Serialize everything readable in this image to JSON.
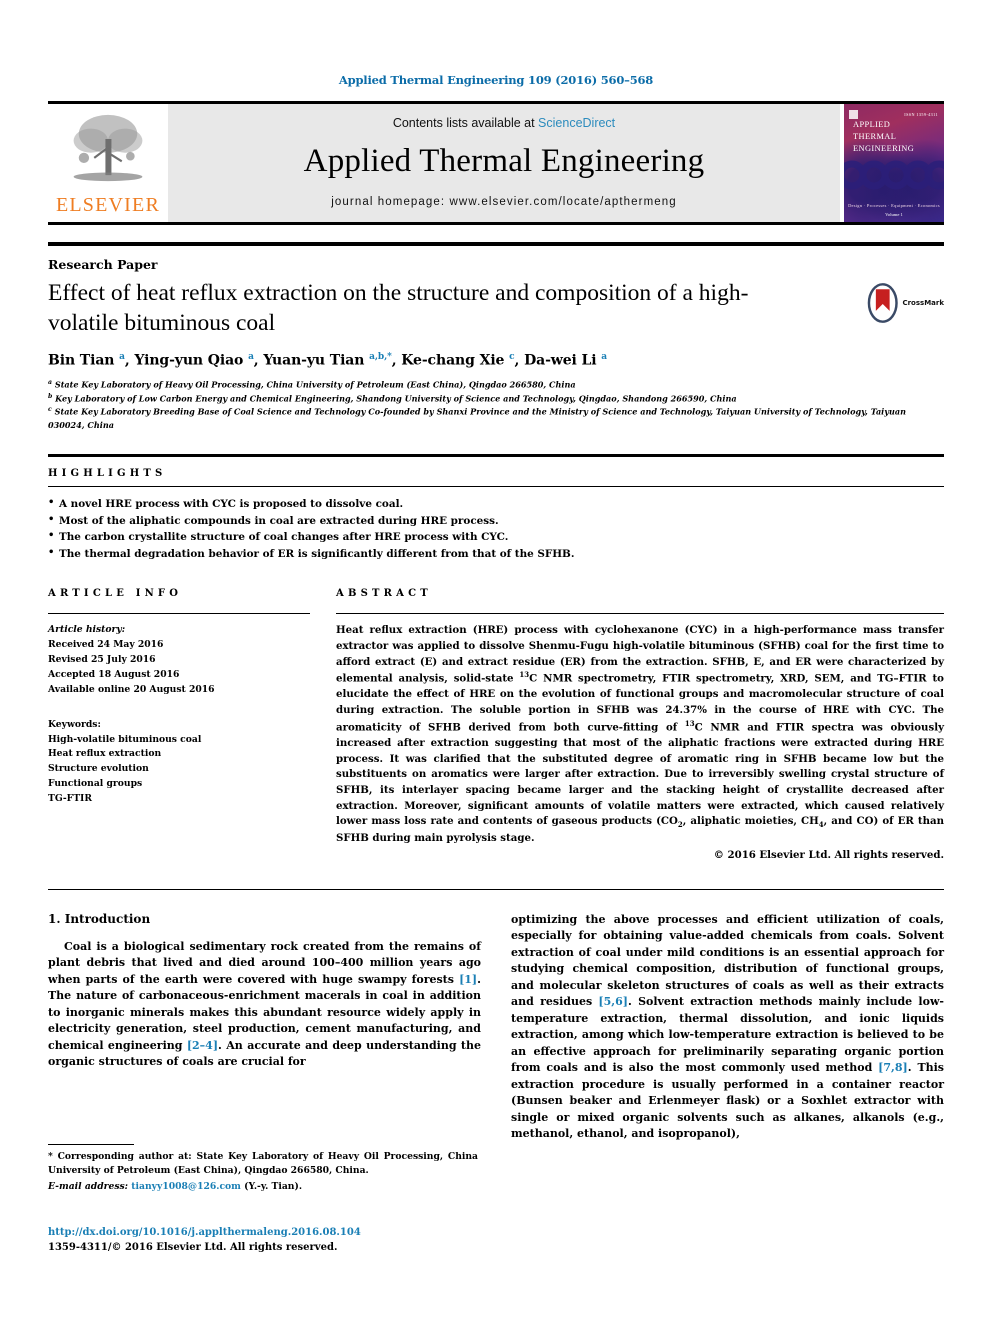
{
  "running_head": "Applied Thermal Engineering 109 (2016) 560–568",
  "masthead": {
    "contents_prefix": "Contents lists available at ",
    "sciencedirect": "ScienceDirect",
    "journal_name": "Applied Thermal Engineering",
    "homepage": "journal homepage: www.elsevier.com/locate/apthermeng",
    "publisher": "ELSEVIER",
    "cover": {
      "line1": "APPLIED",
      "line2": "THERMAL",
      "line3": "ENGINEERING",
      "footer": "Design · Processes · Equipment · Economics",
      "volume": "Volume 1",
      "issn": "ISSN 1359-4311"
    },
    "colors": {
      "link": "#2b8bbd",
      "elsevier_orange": "#ef7d22",
      "band_gray": "#e8e8e8"
    }
  },
  "article": {
    "type_label": "Research Paper",
    "title": "Effect of heat reflux extraction on the structure and composition of a high-volatile bituminous coal",
    "crossmark_label": "CrossMark",
    "authors_html": "Bin Tian <sup>a</sup>, Ying-yun Qiao <sup>a</sup>, Yuan-yu Tian <sup>a,b,</sup><sup>*</sup>, Ke-chang Xie <sup>c</sup>, Da-wei Li <sup>a</sup>",
    "affiliations": [
      "a State Key Laboratory of Heavy Oil Processing, China University of Petroleum (East China), Qingdao 266580, China",
      "b Key Laboratory of Low Carbon Energy and Chemical Engineering, Shandong University of Science and Technology, Qingdao, Shandong 266590, China",
      "c State Key Laboratory Breeding Base of Coal Science and Technology Co-founded by Shanxi Province and the Ministry of Science and Technology, Taiyuan University of Technology, Taiyuan 030024, China"
    ]
  },
  "highlights": {
    "heading": "HIGHLIGHTS",
    "items": [
      "A novel HRE process with CYC is proposed to dissolve coal.",
      "Most of the aliphatic compounds in coal are extracted during HRE process.",
      "The carbon crystallite structure of coal changes after HRE process with CYC.",
      "The thermal degradation behavior of ER is significantly different from that of the SFHB."
    ]
  },
  "article_info": {
    "heading": "ARTICLE INFO",
    "history_label": "Article history:",
    "history": [
      "Received 24 May 2016",
      "Revised 25 July 2016",
      "Accepted 18 August 2016",
      "Available online 20 August 2016"
    ],
    "keywords_label": "Keywords:",
    "keywords": [
      "High-volatile bituminous coal",
      "Heat reflux extraction",
      "Structure evolution",
      "Functional groups",
      "TG-FTIR"
    ]
  },
  "abstract": {
    "heading": "ABSTRACT",
    "paragraph_html": "Heat reflux extraction (HRE) process with cyclohexanone (CYC) in a high-performance mass transfer extractor was applied to dissolve Shenmu-Fugu high-volatile bituminous (SFHB) coal for the first time to afford extract (E) and extract residue (ER) from the extraction. SFHB, E, and ER were characterized by elemental analysis, solid-state <sup class=\"sm\">13</sup>C NMR spectrometry, FTIR spectrometry, XRD, SEM, and TG–FTIR to elucidate the effect of HRE on the evolution of functional groups and macromolecular structure of coal during extraction. The soluble portion in SFHB was 24.37% in the course of HRE with CYC. The aromaticity of SFHB derived from both curve-fitting of <sup class=\"sm\">13</sup>C NMR and FTIR spectra was obviously increased after extraction suggesting that most of the aliphatic fractions were extracted during HRE process. It was clarified that the substituted degree of aromatic ring in SFHB became low but the substituents on aromatics were larger after extraction. Due to irreversibly swelling crystal structure of SFHB, its interlayer spacing became larger and the stacking height of crystallite decreased after extraction. Moreover, significant amounts of volatile matters were extracted, which caused relatively lower mass loss rate and contents of gaseous products (CO<sub class=\"sm\">2</sub>, aliphatic moieties, CH<sub class=\"sm\">4</sub>, and CO) of ER than SFHB during main pyrolysis stage.",
    "copyright": "© 2016 Elsevier Ltd. All rights reserved."
  },
  "body": {
    "section_number_title": "1. Introduction",
    "left_paragraph_html": "Coal is a biological sedimentary rock created from the remains of plant debris that lived and died around 100–400 million years ago when parts of the earth were covered with huge swampy forests <span class=\"lnk\">[1]</span>. The nature of carbonaceous-enrichment macerals in coal in addition to inorganic minerals makes this abundant resource widely apply in electricity generation, steel production, cement manufacturing, and chemical engineering <span class=\"lnk\">[2–4]</span>. An accurate and deep understanding the organic structures of coals are crucial for",
    "right_paragraph_html": "optimizing the above processes and efficient utilization of coals, especially for obtaining value-added chemicals from coals. Solvent extraction of coal under mild conditions is an essential approach for studying chemical composition, distribution of functional groups, and molecular skeleton structures of coals as well as their extracts and residues <span class=\"lnk\">[5,6]</span>. Solvent extraction methods mainly include low-temperature extraction, thermal dissolution, and ionic liquids extraction, among which low-temperature extraction is believed to be an effective approach for preliminarily separating organic portion from coals and is also the most commonly used method <span class=\"lnk\">[7,8]</span>. This extraction procedure is usually performed in a container reactor (Bunsen beaker and Erlenmeyer flask) or a Soxhlet extractor with single or mixed organic solvents such as alkanes, alkanols (e.g., methanol, ethanol, and isopropanol),"
  },
  "footnotes": {
    "corresponding_html": "* Corresponding author at: State Key Laboratory of Heavy Oil Processing, China University of Petroleum (East China), Qingdao 266580, China.",
    "email_label": "E-mail address:",
    "email": "tianyy1008@126.com",
    "email_owner": "(Y.-y. Tian).",
    "doi": "http://dx.doi.org/10.1016/j.applthermaleng.2016.08.104",
    "issn_line": "1359-4311/© 2016 Elsevier Ltd. All rights reserved."
  }
}
